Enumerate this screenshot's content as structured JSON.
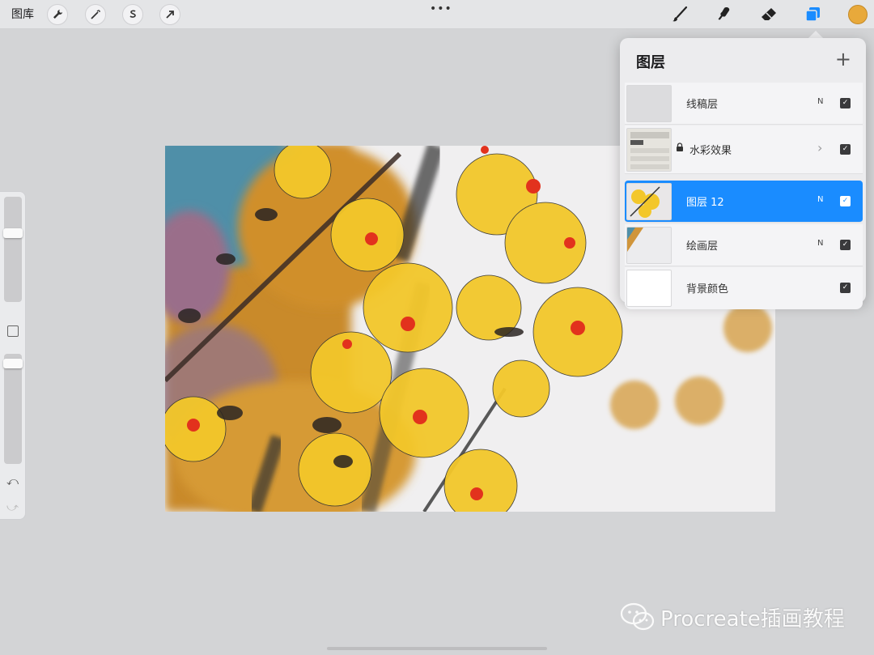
{
  "toolbar": {
    "gallery_label": "图库",
    "left_tools": [
      {
        "icon": "wrench-icon"
      },
      {
        "icon": "magic-wand-icon"
      },
      {
        "icon": "selection-s-icon"
      },
      {
        "icon": "transform-arrow-icon"
      }
    ],
    "more_label": "•••",
    "right_tools": [
      {
        "icon": "brush-icon"
      },
      {
        "icon": "smudge-icon"
      },
      {
        "icon": "eraser-icon"
      },
      {
        "icon": "layers-icon"
      }
    ],
    "current_color": "#e8a93b",
    "accent_color": "#1a8cff"
  },
  "sidebar": {
    "brush_size_level": 0.88,
    "opacity_level": 0.95,
    "undo_icon": "undo-icon",
    "redo_icon": "redo-icon"
  },
  "layers_panel": {
    "title": "图层",
    "add_label": "+",
    "layers": [
      {
        "name": "线稿层",
        "blend": "N",
        "visible": true,
        "locked": false,
        "group": false,
        "active": false
      },
      {
        "name": "水彩效果",
        "blend": "",
        "visible": true,
        "locked": true,
        "group": true,
        "active": false
      },
      {
        "name": "图层 12",
        "blend": "N",
        "visible": true,
        "locked": false,
        "group": false,
        "active": true
      },
      {
        "name": "绘画层",
        "blend": "N",
        "visible": true,
        "locked": false,
        "group": false,
        "active": false
      },
      {
        "name": "背景颜色",
        "blend": "",
        "visible": true,
        "locked": false,
        "group": false,
        "active": false
      }
    ]
  },
  "watermark": {
    "text": "Procreate插画教程"
  }
}
